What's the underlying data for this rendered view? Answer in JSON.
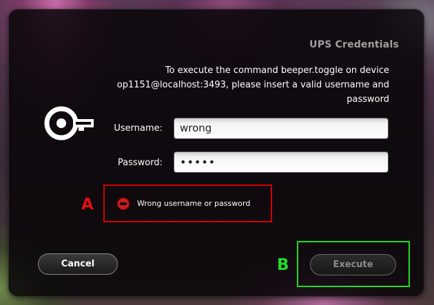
{
  "dialog": {
    "title": "UPS Credentials",
    "message": "To execute the command beeper.toggle on device op1151@localhost:3493, please insert a valid username and password"
  },
  "icons": {
    "key": "key-icon",
    "error": "error-icon"
  },
  "form": {
    "username_label": "Username:",
    "username_value": "wrong",
    "password_label": "Password:",
    "password_value": "•••••"
  },
  "error": {
    "message": "Wrong username or password"
  },
  "buttons": {
    "cancel": "Cancel",
    "execute": "Execute"
  },
  "annotations": {
    "a_label": "A",
    "b_label": "B",
    "a_color": "#d40000",
    "b_color": "#22dd22"
  }
}
